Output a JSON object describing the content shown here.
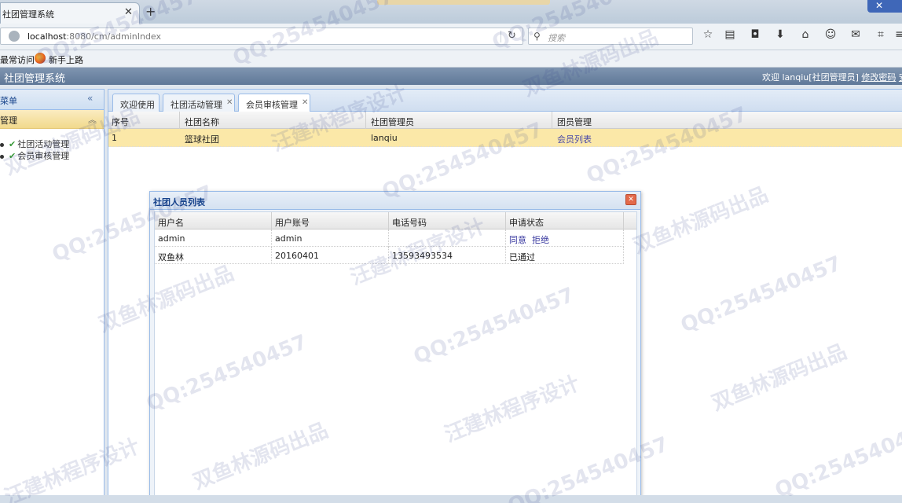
{
  "browser": {
    "tab_title": "社团管理系统",
    "url_host": "localhost",
    "url_rest": ":8080/cm/adminIndex",
    "search_placeholder": "搜索",
    "bookmarks": [
      "最常访问",
      "新手上路"
    ]
  },
  "app": {
    "title": "社团管理系统",
    "welcome": "欢迎 lanqiu[社团管理员]",
    "change_password": "修改密码",
    "logout": "安"
  },
  "sidebar": {
    "title": "菜单",
    "section": "管理",
    "items": [
      {
        "label": "社团活动管理"
      },
      {
        "label": "会员审核管理"
      }
    ]
  },
  "tabs": [
    {
      "label": "欢迎使用"
    },
    {
      "label": "社团活动管理"
    },
    {
      "label": "会员审核管理"
    }
  ],
  "grid": {
    "columns": [
      "序号",
      "社团名称",
      "社团管理员",
      "团员管理"
    ],
    "rows": [
      {
        "index": "1",
        "name": "篮球社团",
        "admin": "lanqiu",
        "action": "会员列表"
      }
    ]
  },
  "dialog": {
    "title": "社团人员列表",
    "columns": [
      "用户名",
      "用户账号",
      "电话号码",
      "申请状态"
    ],
    "rows": [
      {
        "username": "admin",
        "account": "admin",
        "phone": "",
        "approve": "同意",
        "reject": "拒绝"
      },
      {
        "username": "双鱼林",
        "account": "20160401",
        "phone": "13593493534",
        "status": "已通过"
      }
    ]
  },
  "watermark": {
    "qq": "QQ:254540457",
    "name1": "双鱼林源码出品",
    "name2": "汪建林程序设计"
  }
}
